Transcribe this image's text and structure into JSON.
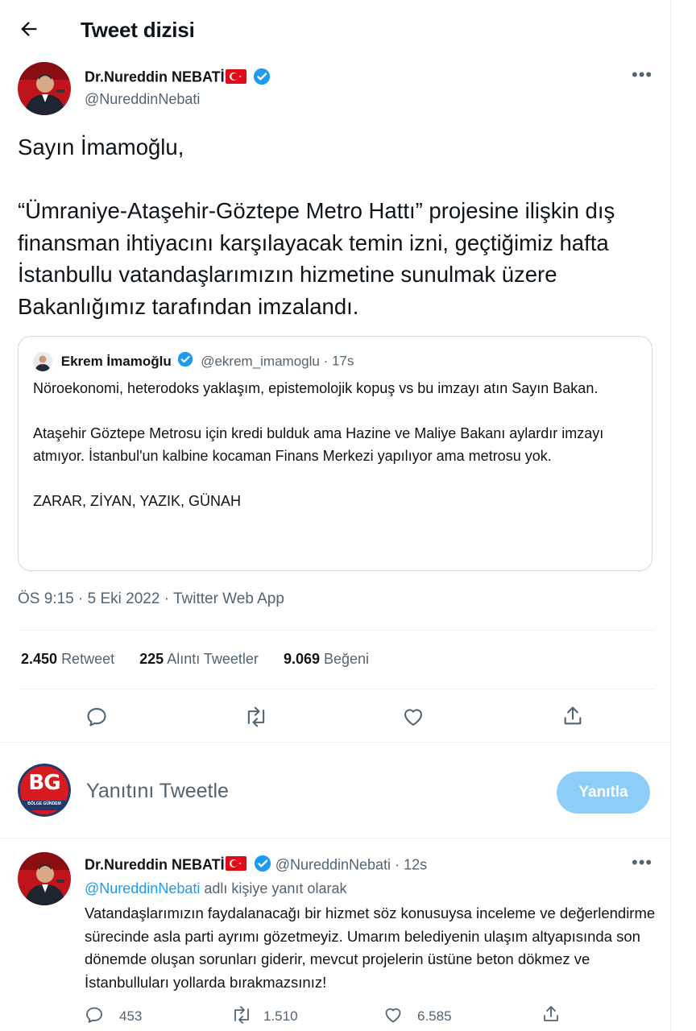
{
  "header": {
    "title": "Tweet dizisi"
  },
  "main_tweet": {
    "author_name": "Dr.Nureddin NEBATİ",
    "author_handle": "@NureddinNebati",
    "text": "Sayın İmamoğlu,\n\n“Ümraniye-Ataşehir-Göztepe Metro Hattı” projesine ilişkin dış finansman ihtiyacını karşılayacak temin izni, geçtiğimiz hafta İstanbullu vatandaşlarımızın hizmetine sunulmak üzere Bakanlığımız tarafından imzalandı.",
    "quote": {
      "author_name": "Ekrem İmamoğlu",
      "author_handle": "@ekrem_imamoglu",
      "time": "17s",
      "text": "Nöroekonomi, heterodoks yaklaşım, epistemolojik kopuş vs bu imzayı atın Sayın Bakan.\n\nAtaşehir Göztepe Metrosu için kredi bulduk ama Hazine ve Maliye Bakanı aylardır imzayı atmıyor. İstanbul'un kalbine kocaman Finans Merkezi yapılıyor ama metrosu yok.\n\nZARAR, ZİYAN, YAZIK, GÜNAH"
    },
    "time": "ÖS 9:15",
    "date": "5 Eki 2022",
    "source": "Twitter Web App",
    "stats": {
      "retweets": "2.450",
      "retweets_label": "Retweet",
      "quotes": "225",
      "quotes_label": "Alıntı Tweetler",
      "likes": "9.069",
      "likes_label": "Beğeni"
    }
  },
  "reply_box": {
    "avatar_text": "BG",
    "avatar_subtext": "BÖLGE GÜNDEM",
    "placeholder": "Yanıtını Tweetle",
    "button_label": "Yanıtla"
  },
  "reply_tweet": {
    "author_name": "Dr.Nureddin NEBATİ",
    "author_handle": "@NureddinNebati",
    "time": "12s",
    "reply_to_mention": "@NureddinNebati",
    "reply_to_suffix": "adlı kişiye yanıt olarak",
    "text": "Vatandaşlarımızın faydalanacağı bir hizmet söz konusuysa inceleme ve değerlendirme sürecinde asla parti ayrımı gözetmeyiz. Umarım belediyenin ulaşım altyapısında son dönemde oluşan sorunları giderir, mevcut projelerin üstüne beton dökmez ve İstanbulluları yollarda bırakmazsınız!",
    "replies": "453",
    "retweets": "1.510",
    "likes": "6.585"
  },
  "colors": {
    "accent": "#1d9bf0",
    "reply_button": "#8ecdf8",
    "secondary_text": "#536471",
    "flag_red": "#e30a17"
  },
  "icons": [
    "back-arrow-icon",
    "verified-badge-icon",
    "turkish-flag-icon",
    "more-icon",
    "reply-icon",
    "retweet-icon",
    "like-icon",
    "share-icon"
  ]
}
